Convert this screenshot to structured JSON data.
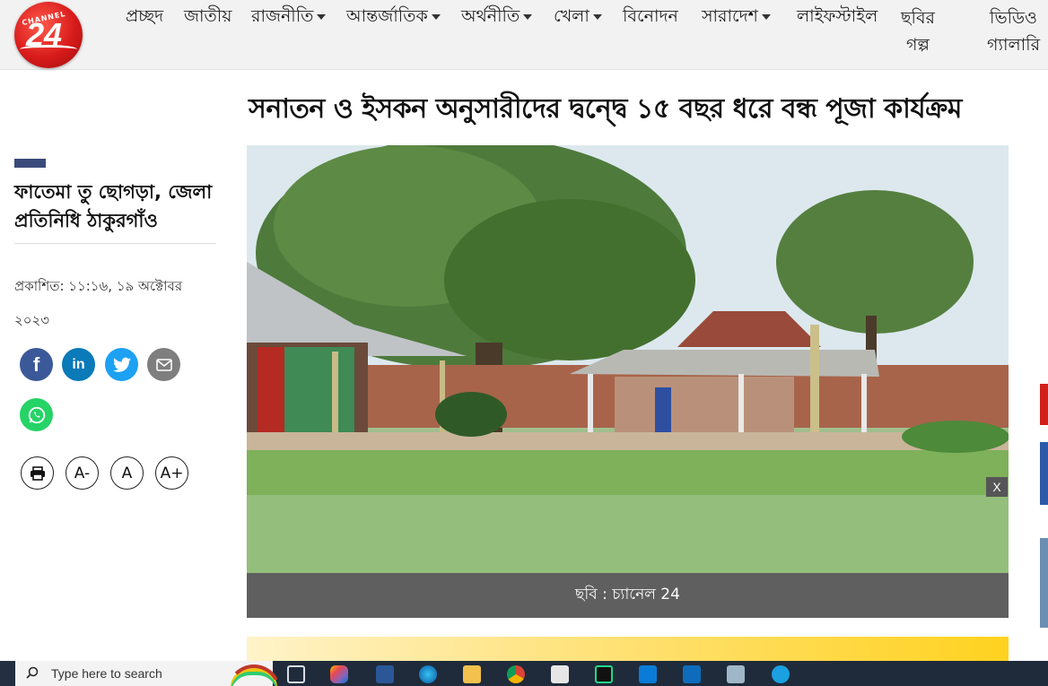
{
  "header": {
    "logo_label": "CHANNEL",
    "logo_number": "24",
    "nav": [
      {
        "label": "প্রচ্ছদ",
        "dropdown": false
      },
      {
        "label": "জাতীয়",
        "dropdown": false
      },
      {
        "label": "রাজনীতি",
        "dropdown": true
      },
      {
        "label": "আন্তর্জাতিক",
        "dropdown": true
      },
      {
        "label": "অর্থনীতি",
        "dropdown": true
      },
      {
        "label": "খেলা",
        "dropdown": true
      },
      {
        "label": "বিনোদন",
        "dropdown": false
      },
      {
        "label": "সারাদেশ",
        "dropdown": true
      },
      {
        "label": "লাইফস্টাইল",
        "dropdown": false
      },
      {
        "label_line1": "ছবির",
        "label_line2": "গল্প",
        "dropdown": false
      },
      {
        "label_line1": "ভিডিও",
        "label_line2": "গ্যালারি",
        "dropdown": false
      }
    ]
  },
  "article": {
    "headline": "সনাতন ও ইসকন অনুসারীদের দ্বন্দ্বে ১৫ বছর ধরে বন্ধ পূজা কার্যক্রম",
    "author": "ফাতেমা তু ছোগড়া, জেলা প্রতিনিধি ঠাকুরগাঁও",
    "published": "প্রকাশিত: ১১:১৬, ১৯ অক্টোবর ২০২৩",
    "photo_caption": "ছবি : চ্যানেল 24",
    "close_label": "X"
  },
  "share": {
    "facebook_icon": "facebook-icon",
    "linkedin_icon": "linkedin-icon",
    "twitter_icon": "twitter-icon",
    "email_icon": "email-icon",
    "whatsapp_icon": "whatsapp-icon"
  },
  "tools": {
    "decrease": "A-",
    "normal": "A",
    "increase": "A+"
  },
  "taskbar": {
    "search_placeholder": "Type here to search"
  },
  "colors": {
    "brand_red": "#d81b1b",
    "author_bar": "#3a4a7a",
    "caption_bg": "#5f5f5f"
  }
}
